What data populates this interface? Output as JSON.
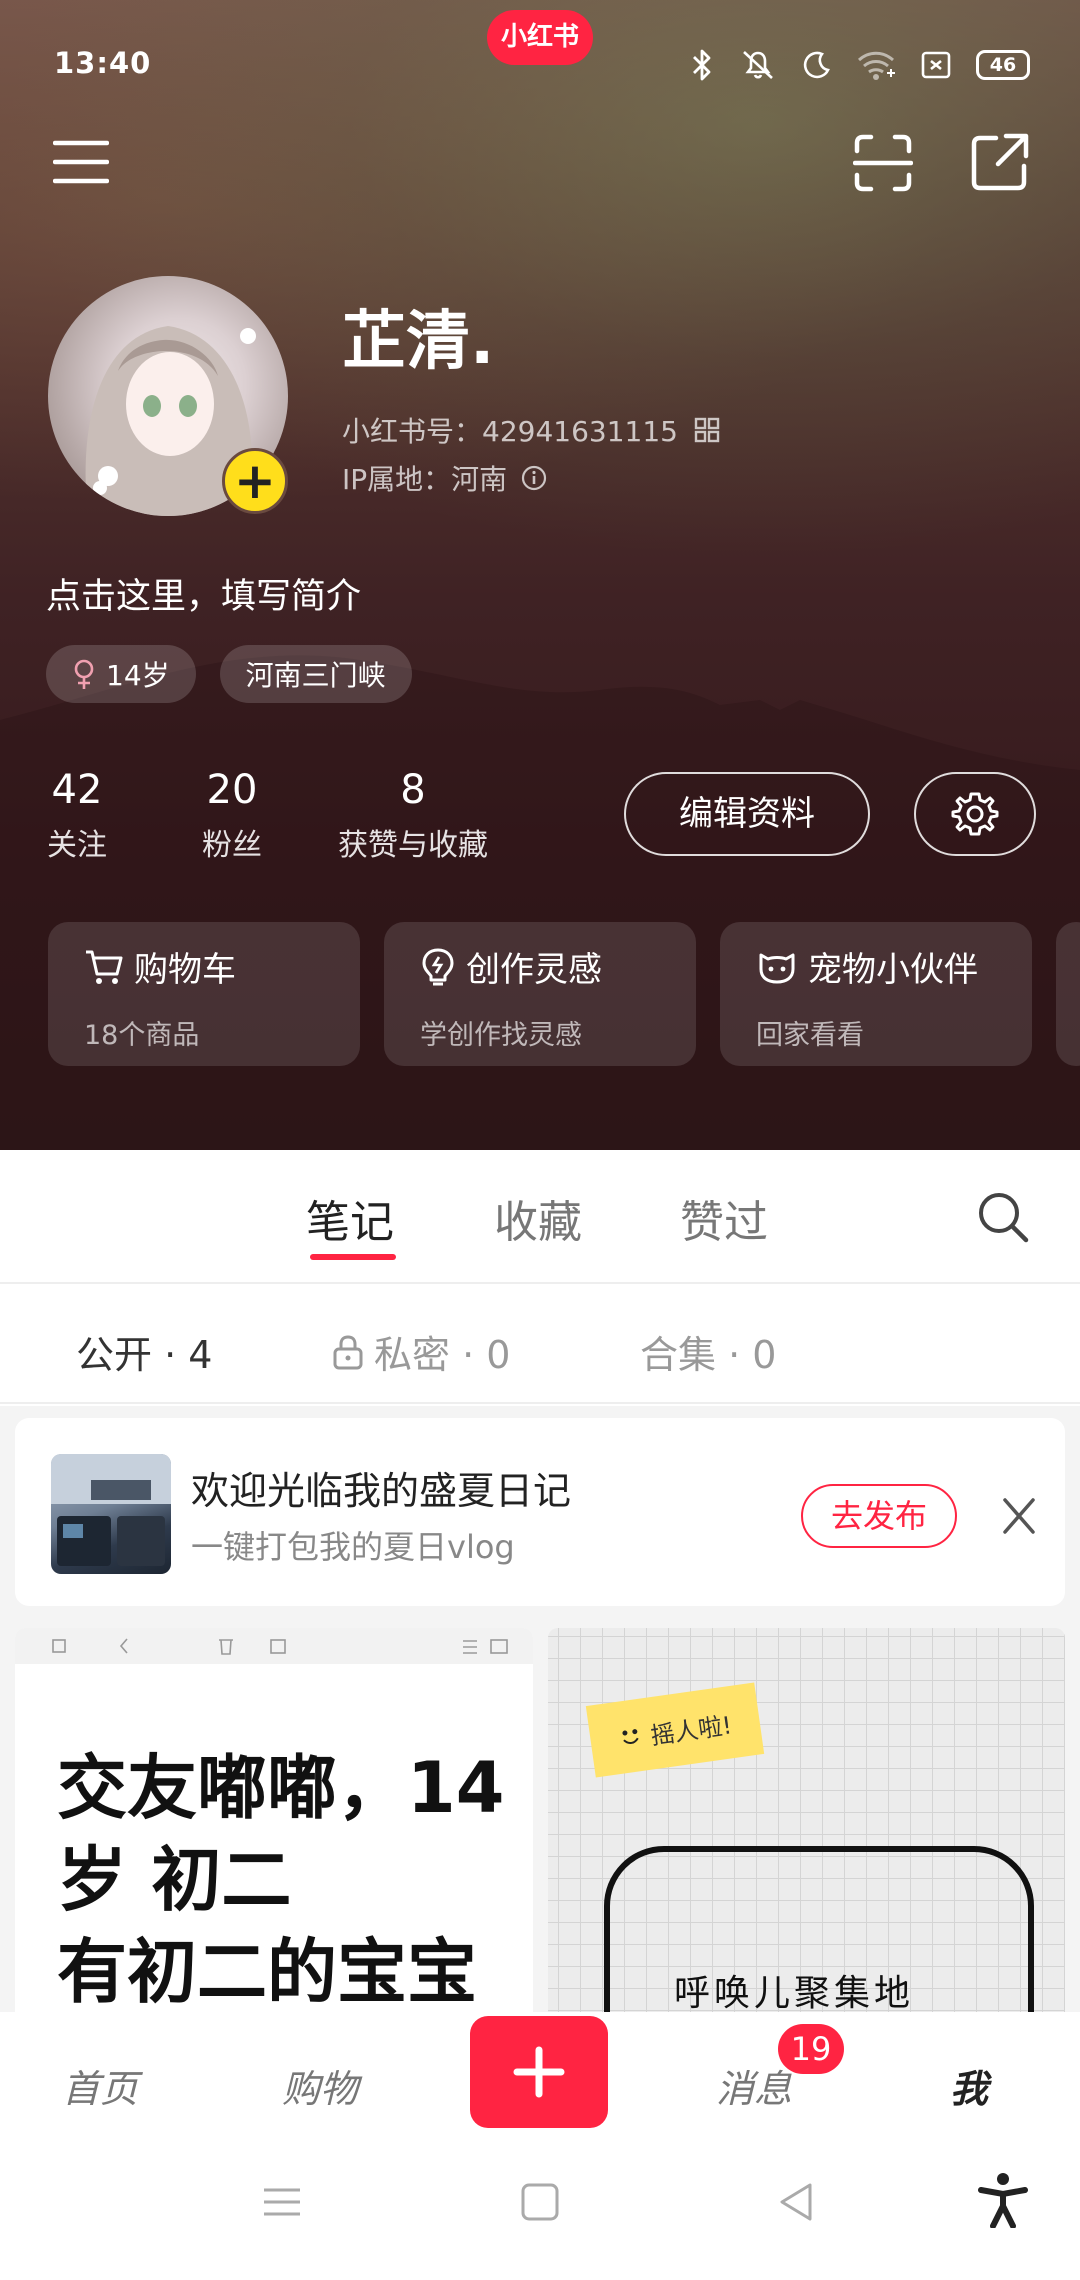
{
  "status_bar": {
    "time": "13:40",
    "app_badge": "小红书",
    "battery": "46"
  },
  "profile": {
    "name": "芷清.",
    "id_label": "小红书号：",
    "id_value": "42941631115",
    "ip_label": "IP属地：",
    "ip_value": "河南",
    "bio": "点击这里，填写简介",
    "tags": [
      {
        "icon": "female-symbol-icon",
        "label": "14岁"
      },
      {
        "label": "河南三门峡"
      }
    ]
  },
  "stats": [
    {
      "value": "42",
      "label": "关注"
    },
    {
      "value": "20",
      "label": "粉丝"
    },
    {
      "value": "8",
      "label": "获赞与收藏"
    }
  ],
  "buttons": {
    "edit_profile": "编辑资料"
  },
  "feature_cards": [
    {
      "icon": "shopping-cart-icon",
      "title": "购物车",
      "subtitle": "18个商品"
    },
    {
      "icon": "lightbulb-icon",
      "title": "创作灵感",
      "subtitle": "学创作找灵感"
    },
    {
      "icon": "pet-icon",
      "title": "宠物小伙伴",
      "subtitle": "回家看看"
    }
  ],
  "tabs": [
    {
      "label": "笔记",
      "active": true
    },
    {
      "label": "收藏"
    },
    {
      "label": "赞过"
    }
  ],
  "subtabs": [
    {
      "label": "公开 · 4",
      "active": true
    },
    {
      "label": "私密 · 0",
      "icon": "lock-icon"
    },
    {
      "label": "合集 · 0"
    }
  ],
  "promo": {
    "title": "欢迎光临我的盛夏日记",
    "subtitle": "一键打包我的夏日vlog",
    "button": "去发布"
  },
  "notes": [
    {
      "text": "交友嘟嘟，14岁 初二\n有初二的宝宝"
    },
    {
      "sticky": "摇人啦!",
      "text": "呼唤儿聚集地"
    }
  ],
  "bottom_nav": [
    {
      "label": "首页"
    },
    {
      "label": "购物"
    },
    {
      "label": "消息",
      "badge": "19"
    },
    {
      "label": "我",
      "active": true
    }
  ],
  "colors": {
    "accent": "#ff2442",
    "badge_yellow": "#ffde1b"
  }
}
